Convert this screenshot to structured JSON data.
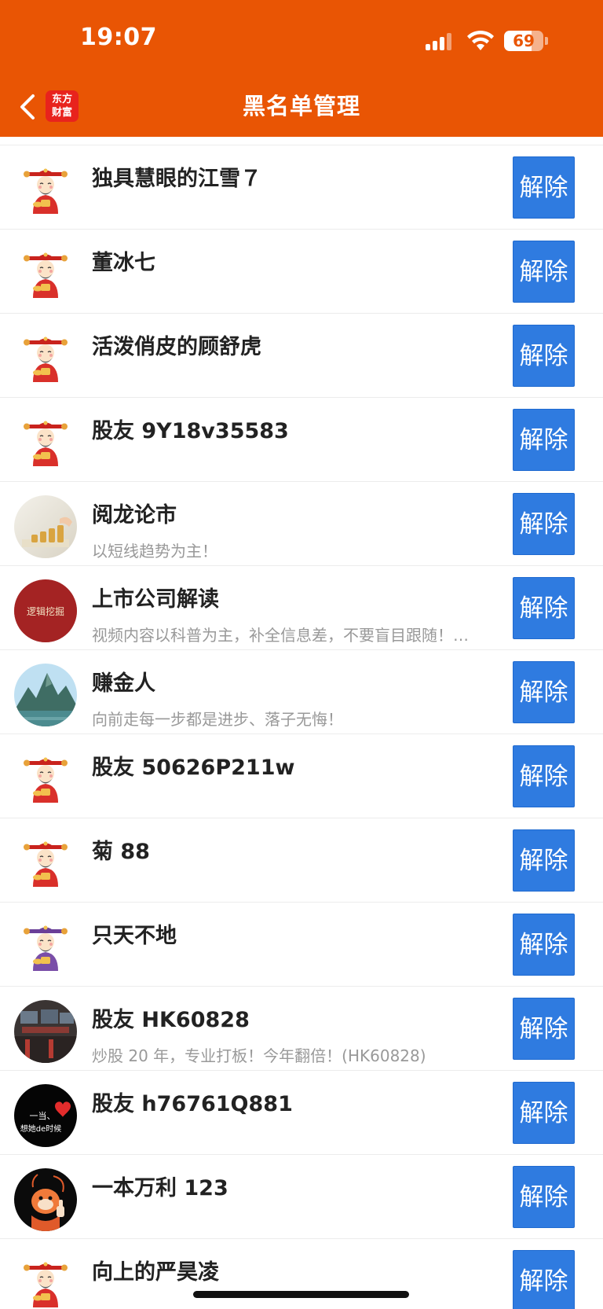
{
  "status_bar": {
    "time": "19:07",
    "battery": "69",
    "battery_level": 0.69
  },
  "header": {
    "title": "黑名单管理",
    "logo_line1": "东方",
    "logo_line2": "财富"
  },
  "colors": {
    "header_bg": "#e95504",
    "button_bg": "#2f7be0",
    "name_text": "#222222",
    "desc_text": "#999999"
  },
  "list": {
    "items": [
      {
        "name": "独具慧眼的江雪７",
        "desc": "",
        "avatar": "caishen-avatar",
        "button": "解除"
      },
      {
        "name": "董冰七",
        "desc": "",
        "avatar": "caishen-avatar",
        "button": "解除"
      },
      {
        "name": "活泼俏皮的顾舒虎",
        "desc": "",
        "avatar": "caishen-avatar",
        "button": "解除"
      },
      {
        "name": "股友 9Y18v35583",
        "desc": "",
        "avatar": "caishen-avatar",
        "button": "解除"
      },
      {
        "name": "阅龙论市",
        "desc": "以短线趋势为主！",
        "avatar": "coins-avatar",
        "button": "解除"
      },
      {
        "name": "上市公司解读",
        "desc": "视频内容以科普为主，补全信息差，不要盲目跟随！…",
        "avatar": "logic-dig-avatar",
        "avatar_text": "逻辑挖掘",
        "button": "解除"
      },
      {
        "name": "赚金人",
        "desc": "向前走每一步都是进步、落子无悔！",
        "avatar": "mountain-avatar",
        "button": "解除"
      },
      {
        "name": "股友 50626P211w",
        "desc": "",
        "avatar": "caishen-avatar",
        "button": "解除"
      },
      {
        "name": "菊 88",
        "desc": "",
        "avatar": "caishen-avatar",
        "button": "解除"
      },
      {
        "name": "只天不地",
        "desc": "",
        "avatar": "purple-caishen-avatar",
        "button": "解除"
      },
      {
        "name": "股友 HK60828",
        "desc": "炒股 20 年，专业打板！今年翻倍！(HK60828)",
        "avatar": "trading-room-avatar",
        "button": "解除"
      },
      {
        "name": "股友 h76761Q881",
        "desc": "",
        "avatar": "heart-text-avatar",
        "avatar_text1": "一当、",
        "avatar_text2": "想她de时候",
        "button": "解除"
      },
      {
        "name": "一本万利 123",
        "desc": "",
        "avatar": "cartoon-thumbsup-avatar",
        "button": "解除"
      },
      {
        "name": "向上的严昊凌",
        "desc": "",
        "avatar": "caishen-avatar",
        "button": "解除"
      }
    ]
  }
}
